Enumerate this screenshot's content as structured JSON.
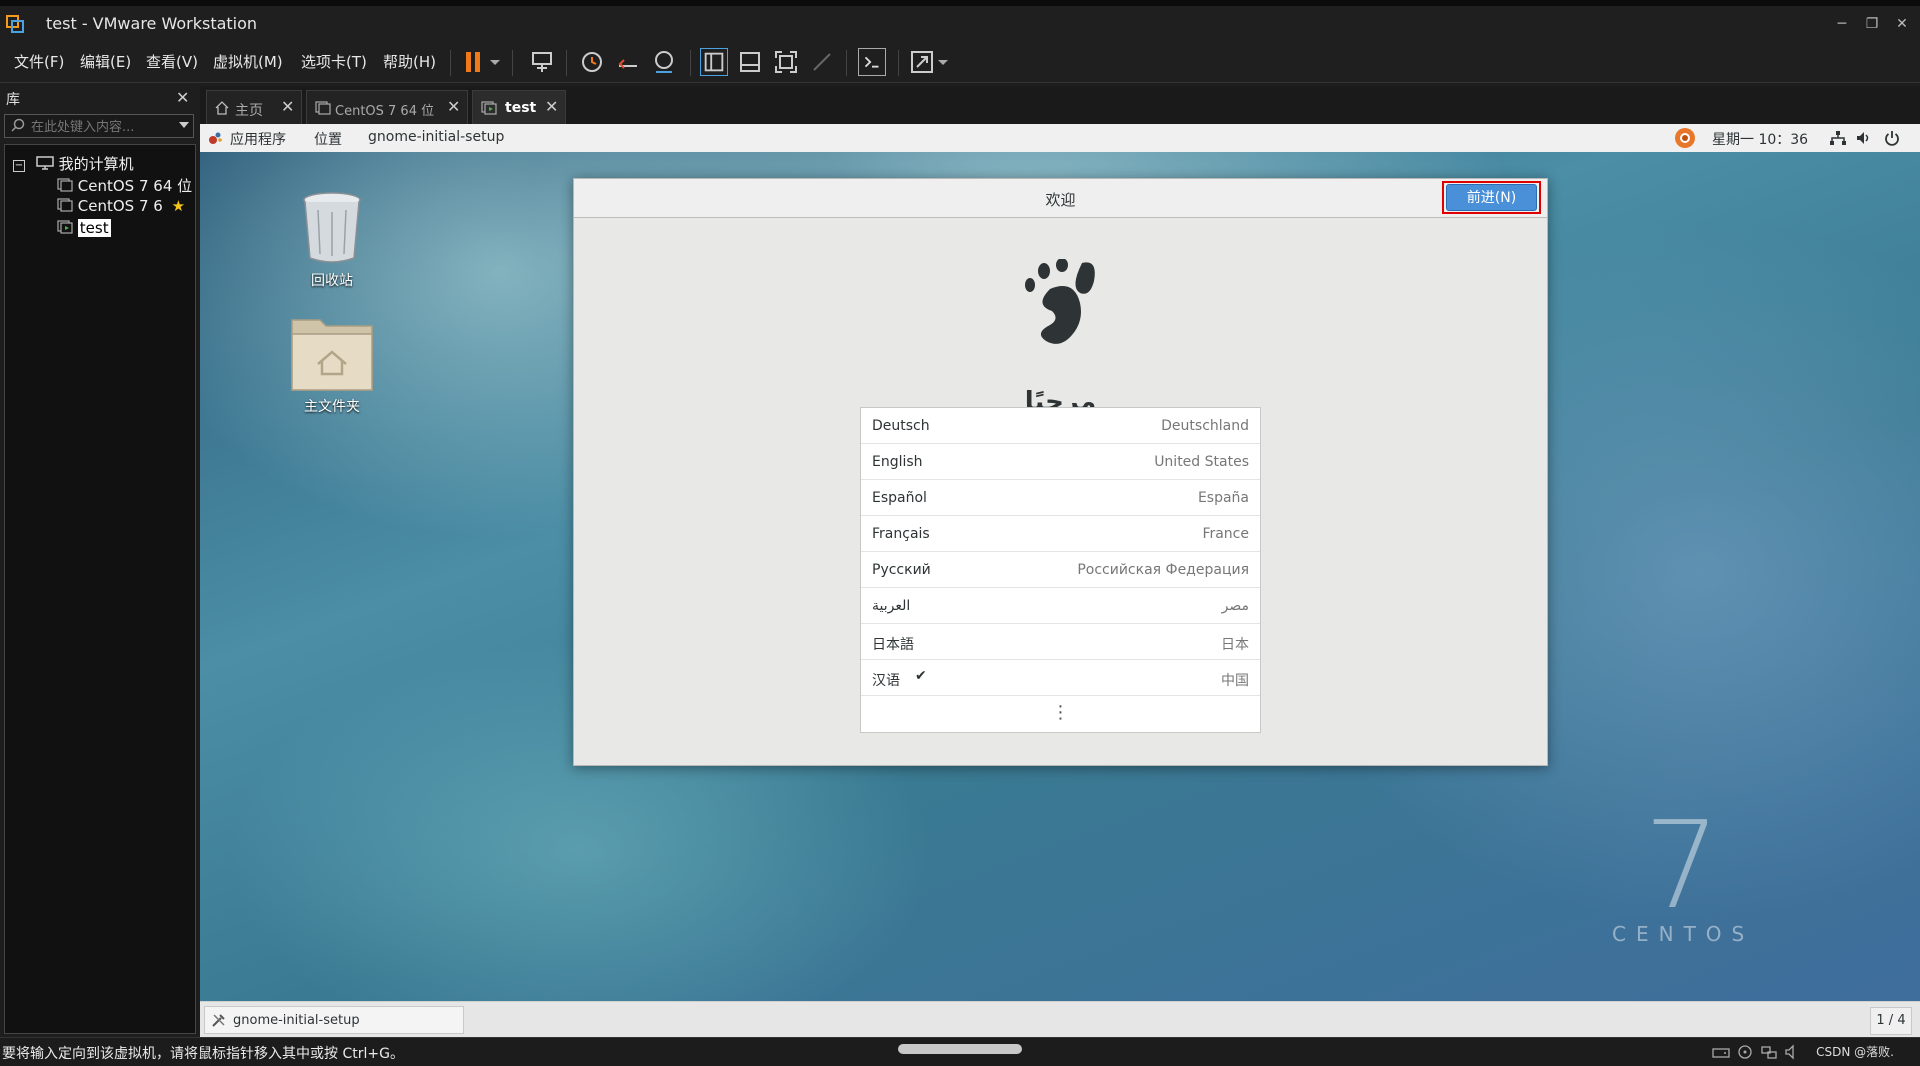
{
  "window": {
    "title": "test - VMware Workstation"
  },
  "menu": [
    {
      "label": "文件(F)"
    },
    {
      "label": "编辑(E)"
    },
    {
      "label": "查看(V)"
    },
    {
      "label": "虚拟机(M)"
    },
    {
      "label": "选项卡(T)"
    },
    {
      "label": "帮助(H)"
    }
  ],
  "library": {
    "title": "库",
    "search_placeholder": "在此处键入内容...",
    "root": "我的计算机",
    "vms": [
      {
        "label": "CentOS 7 64 位"
      },
      {
        "label": "CentOS 7 6"
      },
      {
        "label": "test"
      }
    ]
  },
  "tabs": [
    {
      "label": "主页"
    },
    {
      "label": "CentOS 7 64 位"
    },
    {
      "label": "test"
    }
  ],
  "guest": {
    "top_bar": {
      "applications": "应用程序",
      "places": "位置",
      "app_name": "gnome-initial-setup",
      "clock": "星期一 10：36"
    },
    "desktop_icons": [
      {
        "label": "回收站"
      },
      {
        "label": "主文件夹"
      }
    ],
    "dialog": {
      "title": "欢迎",
      "next_button": "前进(N)",
      "welcome_text": "مرحبًا",
      "languages": [
        {
          "name": "Deutsch",
          "region": "Deutschland"
        },
        {
          "name": "English",
          "region": "United States"
        },
        {
          "name": "Español",
          "region": "España"
        },
        {
          "name": "Français",
          "region": "France"
        },
        {
          "name": "Русский",
          "region": "Российская Федерация"
        },
        {
          "name": "العربية",
          "region": "مصر"
        },
        {
          "name": "日本語",
          "region": "日本"
        },
        {
          "name": "汉语",
          "region": "中国",
          "selected": true
        }
      ],
      "check_mark": "✔",
      "more": "⋮"
    },
    "branding": {
      "number": "7",
      "word": "CENTOS"
    },
    "bottom_bar": {
      "task": "gnome-initial-setup",
      "workspace": "1 / 4"
    }
  },
  "status": {
    "text": "要将输入定向到该虚拟机，请将鼠标指针移入其中或按 Ctrl+G。",
    "watermark": "CSDN @落败."
  },
  "colors": {
    "accent": "#4a90d9",
    "highlight_outline": "#e00000",
    "pause": "#f07a1a"
  }
}
